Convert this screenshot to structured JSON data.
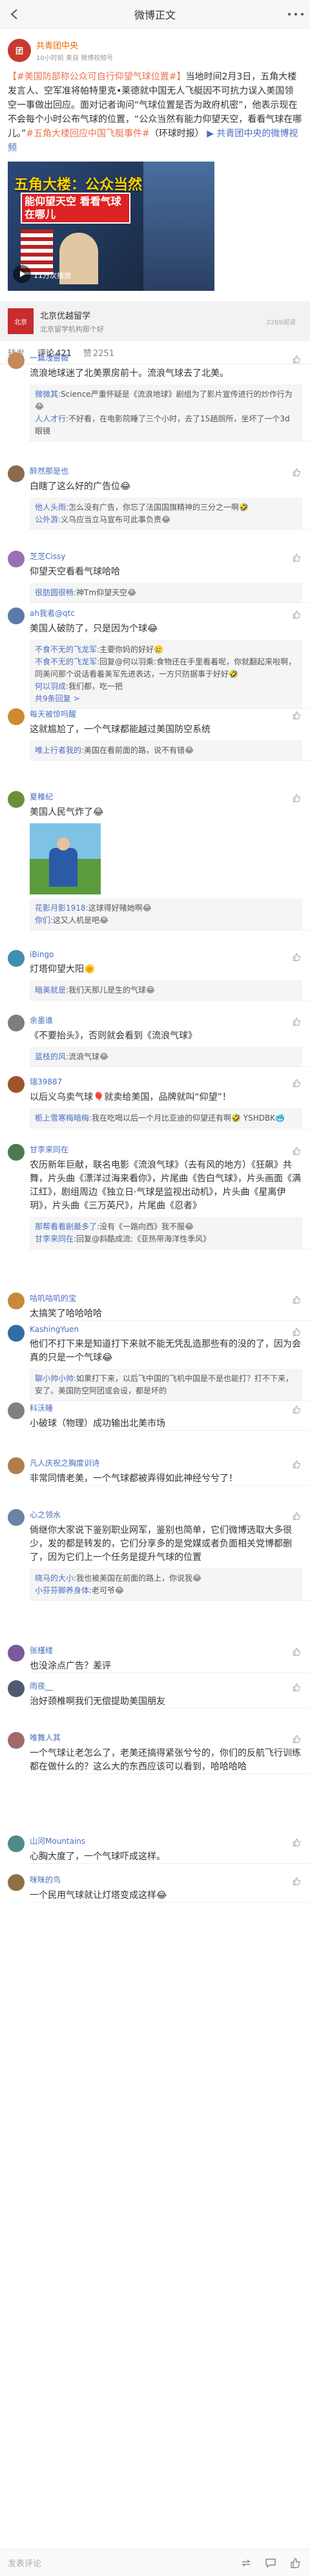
{
  "topbar": {
    "title": "微博正文"
  },
  "post": {
    "author": "共青团中央",
    "avatar_text": "团",
    "meta": "10小时前 来自 微博视频号",
    "hashtag": "【#美国防部称公众可自行仰望气球位置#】",
    "body": "当地时间2月3日，五角大楼发言人、空军准将帕特里克•莱德就中国无人飞艇因不可抗力误入美国领空一事做出回应。面对记者询问“气球位置是否为政府机密”，他表示现在不会每个小时公布气球的位置，“公众当然有能力仰望天空，看看气球在哪儿。”",
    "hashtag2": "#五角大楼回应中国飞艇事件#",
    "tail": "（环球时报）",
    "link_text": "共青团中央的微博视频",
    "video": {
      "headline1": "五角大楼：公众当然",
      "headline2": "能仰望天空 看看气球在哪儿",
      "meta": "11万次播放"
    }
  },
  "repost_card": {
    "avatar_text": "北京",
    "title": "北京优越留学",
    "sub": "北京留学机构那个好",
    "count": "2269阅读"
  },
  "tabs": {
    "repost_label": "转发",
    "repost_count": "",
    "comment_label": "评论",
    "comment_count": "421",
    "like_label": "赞",
    "like_count": "2251"
  },
  "comments": [
    {
      "name": "一篇浅蔷薇",
      "time": "",
      "color": "#c48a5a",
      "likes": "",
      "text": "流浪地球迷了北美票房前十。流浪气球去了北美。",
      "replies": [
        {
          "name": "微微其:",
          "text": "Science严重怀疑是《流浪地球》剧组为了影片宣传进行的炒作行为😂"
        },
        {
          "name": "人人才行:",
          "text": "不好看，在电影院睡了三个小时，去了15趟厕所，坐坏了一个3d眼镜"
        }
      ],
      "more": ""
    },
    {
      "name": "醉然那是也",
      "time": "",
      "color": "#8c6a4e",
      "likes": "",
      "text": "白瞎了这么好的广告位😂",
      "replies": [
        {
          "name": "他人头雨:",
          "text": "怎么没有广告，你忘了法国国旗精神的三分之一啊🤣"
        },
        {
          "name": "公外游:",
          "text": "义乌应当立马宣布可此事负责😂"
        }
      ],
      "more": ""
    },
    {
      "name": "芝芝Cissy",
      "time": "",
      "color": "#9b6fb5",
      "likes": "",
      "text": "仰望天空看看气球哈哈",
      "replies": [
        {
          "name": "很肪圆很畅:",
          "text": "神Tm仰望天空😂"
        }
      ],
      "more": ""
    },
    {
      "name": "ah我者@qtc",
      "time": "",
      "color": "#5c7aa8",
      "likes": "",
      "text": "美国人破防了，只是因为个球😂",
      "replies": [
        {
          "name": "不食不无的飞龙军:",
          "text": "主要你妈的好好🥲"
        },
        {
          "name": "不食不无的飞龙军:",
          "text": "回复@何以羽乘:食物还在手里看着呢，你就翻起来啦啊，同美问那个说话看着美军先进表达，一方只防据事于好好🤣"
        },
        {
          "name": "何以羽成:",
          "text": "我们都，吃一把"
        }
      ],
      "more": "共9条回复 >"
    },
    {
      "name": "每天被惊吗醒",
      "time": "",
      "color": "#d08a2e",
      "likes": "",
      "text": "这就尴尬了，一个气球都能越过美国防空系统",
      "replies": [
        {
          "name": "唯上行者我的:",
          "text": "美国在看前面的路，说不有错😂"
        }
      ],
      "more": ""
    },
    {
      "name": "夏稚纪",
      "time": "",
      "color": "#6d8f3a",
      "likes": "",
      "text": "美国人民气炸了😂",
      "image": true,
      "replies": [
        {
          "name": "花影月影1918:",
          "text": "这球得好赌她啊😂"
        },
        {
          "name": "你们:",
          "text": "这又人机是吧😂"
        }
      ],
      "more": ""
    },
    {
      "name": "iBingo",
      "time": "",
      "color": "#3f8fb0",
      "likes": "",
      "text": "灯塔仰望大阳🌞",
      "replies": [
        {
          "name": "暗美就是:",
          "text": "我们天那儿是生的气球😂"
        }
      ],
      "more": ""
    },
    {
      "name": "余墨谁",
      "time": "",
      "color": "#7e7e7e",
      "likes": "",
      "text": "《不要抬头》，否则就会看到《流浪气球》",
      "replies": [
        {
          "name": "蓝枝的风:",
          "text": "流浪气球😂"
        }
      ],
      "more": ""
    },
    {
      "name": "瑞39887",
      "time": "",
      "color": "#a0522d",
      "likes": "",
      "text": "以后义乌卖气球🎈就卖给美国，品牌就叫“仰望”！",
      "replies": [
        {
          "name": "栀上雪寒梅暗梅:",
          "text": "我在吃喝以后一个月比亚迪的仰望还有啊🤣 YSHDBK🥶"
        }
      ],
      "more": ""
    },
    {
      "name": "甘李来同在",
      "time": "",
      "color": "#4d7a4d",
      "likes": "",
      "text": "农历新年巨献，联名电影《流浪气球》（去有风的地方）《狂飙》共舞，片头曲《漂洋过海来看你》，片尾曲《告白气球》，片头画面《满江红》，剧组周边《独立日·气球是监视出动机》，片头曲《星离伊玥》，片头曲《三万英尺》，片尾曲《忍者》",
      "replies": [
        {
          "name": "那帮看看剧最多了:",
          "text": "没有《一路向西》我不服😂"
        },
        {
          "name": "甘李来同在:",
          "text": "回复@斜酷成流:《亚热带海洋性季风》"
        }
      ],
      "more": ""
    },
    {
      "name": "咕叽咕叽的宝",
      "time": "",
      "color": "#c9893a",
      "likes": "",
      "text": "太搞笑了哈哈哈哈",
      "replies": [],
      "more": ""
    },
    {
      "name": "KashingYuen",
      "time": "",
      "color": "#2f6fa5",
      "likes": "",
      "text": "他们不打下来是知道打下来就不能无凭乱造那些有的没的了，因为会真的只是一个气球😂",
      "replies": [
        {
          "name": "聊小帅小帅:",
          "text": "如果打下来，以后飞中国的飞机中国是不是也能打？打不下来，安了。美国防空阿团或会设，都是坏的"
        }
      ],
      "more": ""
    },
    {
      "name": "科沃睡",
      "time": "",
      "color": "#808080",
      "likes": "",
      "text": "小破球（物理）成功输出北美市场",
      "replies": [],
      "more": ""
    },
    {
      "name": "凡人庆祝之胸度训诗",
      "time": "",
      "color": "#b07d4f",
      "likes": "",
      "text": "非常同情老美，一个气球都被弄得如此神经兮兮了！",
      "replies": [],
      "more": ""
    },
    {
      "name": "心之领水",
      "time": "",
      "color": "#6b83a8",
      "likes": "",
      "text": "倘继你大家说下鉴别职业网军，鉴别也简单，它们微博选取大多很少，发的都是转发的，它们分享多的是党媒或者负面相关党博都删了，因为它们上一个任务是提升气球的位置",
      "replies": [
        {
          "name": "晓马的大小:",
          "text": "我也被美国在前面的路上，你说我😂"
        },
        {
          "name": "小芬芬脚养身体:",
          "text": "老可爷😂"
        }
      ],
      "more": ""
    },
    {
      "name": "张槿缕",
      "time": "",
      "color": "#7a5a9a",
      "likes": "",
      "text": "也没涂点广告？差评",
      "replies": [],
      "more": ""
    },
    {
      "name": "雨夜__",
      "time": "",
      "color": "#505a70",
      "likes": "",
      "text": "治好颈椎啊我们无偿提助美国朋友",
      "replies": [],
      "more": ""
    },
    {
      "name": "唯舞人其",
      "time": "",
      "color": "#a06a6a",
      "likes": "",
      "text": "一个气球让老怎么了，老美还搞得紧张兮兮的，你们的反航飞行训练都在做什么的？这么大的东西应该可以看到，哈哈哈哈",
      "replies": [],
      "more": ""
    },
    {
      "name": "山河Mountains",
      "time": "",
      "color": "#4f8a8b",
      "likes": "",
      "text": "心胸大度了，一个气球吓成这样。",
      "replies": [],
      "more": ""
    },
    {
      "name": "咪咪的鸟",
      "time": "",
      "color": "#8d7046",
      "likes": "",
      "text": "一个民用气球就让灯塔变成这样😂",
      "replies": [],
      "more": ""
    }
  ],
  "bottombar": {
    "placeholder": "发表评论"
  }
}
